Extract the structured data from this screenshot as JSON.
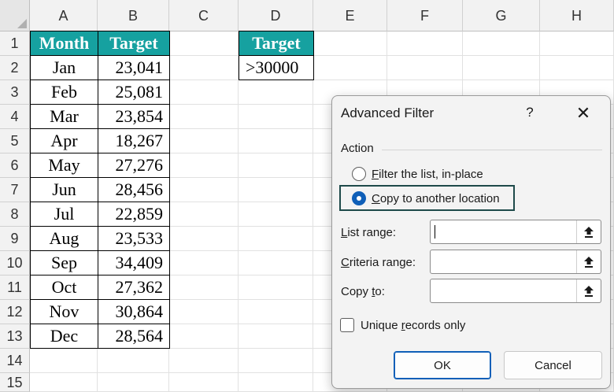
{
  "sheet": {
    "columns": [
      "A",
      "B",
      "C",
      "D",
      "E",
      "F",
      "G",
      "H"
    ],
    "rows": [
      "1",
      "2",
      "3",
      "4",
      "5",
      "6",
      "7",
      "8",
      "9",
      "10",
      "11",
      "12",
      "13",
      "14",
      "15"
    ],
    "table_headers": {
      "month": "Month",
      "target": "Target"
    },
    "data": [
      {
        "month": "Jan",
        "target": "23,041"
      },
      {
        "month": "Feb",
        "target": "25,081"
      },
      {
        "month": "Mar",
        "target": "23,854"
      },
      {
        "month": "Apr",
        "target": "18,267"
      },
      {
        "month": "May",
        "target": "27,276"
      },
      {
        "month": "Jun",
        "target": "28,456"
      },
      {
        "month": "Jul",
        "target": "22,859"
      },
      {
        "month": "Aug",
        "target": "23,533"
      },
      {
        "month": "Sep",
        "target": "34,409"
      },
      {
        "month": "Oct",
        "target": "27,362"
      },
      {
        "month": "Nov",
        "target": "30,864"
      },
      {
        "month": "Dec",
        "target": "28,564"
      }
    ],
    "criteria": {
      "header": "Target",
      "value": ">30000"
    },
    "colors": {
      "header_fill": "#16a1a0",
      "header_text": "#ffffff"
    }
  },
  "dialog": {
    "title": "Advanced Filter",
    "help": "?",
    "close": "✕",
    "action_label": "Action",
    "radio_filter": {
      "first": "F",
      "rest": "ilter the list, in-place",
      "selected": false
    },
    "radio_copy": {
      "first": "C",
      "rest": "opy to another location",
      "selected": true
    },
    "list_range": {
      "first": "L",
      "rest": "ist range:",
      "value": ""
    },
    "criteria_range": {
      "first": "C",
      "rest": "riteria range:",
      "value": ""
    },
    "copy_to": {
      "pre": "Copy ",
      "key": "t",
      "post": "o:",
      "value": ""
    },
    "unique": {
      "pre": "Unique ",
      "key": "r",
      "post": "ecords only",
      "checked": false
    },
    "ok": "OK",
    "cancel": "Cancel",
    "collapse_icon": "range-collapse-icon",
    "accent": "#0f5fb8"
  }
}
